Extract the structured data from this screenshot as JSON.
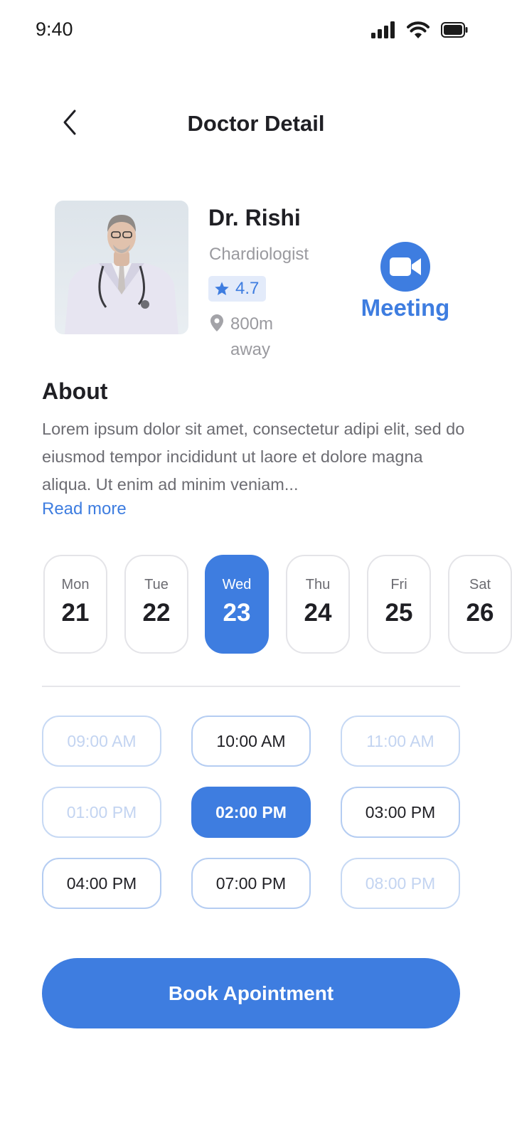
{
  "status_bar": {
    "time": "9:40"
  },
  "header": {
    "title": "Doctor Detail"
  },
  "doctor": {
    "name": "Dr. Rishi",
    "specialty": "Chardiologist",
    "rating": "4.7",
    "distance_line1": "800m",
    "distance_line2": "away",
    "meeting_label": "Meeting"
  },
  "about": {
    "title": "About",
    "text": "Lorem ipsum dolor sit amet, consectetur adipi elit, sed do eiusmod tempor incididunt ut laore et dolore magna aliqua. Ut enim ad minim veniam...",
    "read_more": "Read more"
  },
  "days": [
    {
      "name": "Mon",
      "num": "21"
    },
    {
      "name": "Tue",
      "num": "22"
    },
    {
      "name": "Wed",
      "num": "23"
    },
    {
      "name": "Thu",
      "num": "24"
    },
    {
      "name": "Fri",
      "num": "25"
    },
    {
      "name": "Sat",
      "num": "26"
    }
  ],
  "selected_day": "Wed",
  "time_slots": [
    {
      "label": "09:00 AM",
      "state": "disabled"
    },
    {
      "label": "10:00 AM",
      "state": "available"
    },
    {
      "label": "11:00 AM",
      "state": "disabled"
    },
    {
      "label": "01:00 PM",
      "state": "disabled"
    },
    {
      "label": "02:00 PM",
      "state": "selected"
    },
    {
      "label": "03:00 PM",
      "state": "available"
    },
    {
      "label": "04:00 PM",
      "state": "available"
    },
    {
      "label": "07:00 PM",
      "state": "available"
    },
    {
      "label": "08:00 PM",
      "state": "disabled"
    }
  ],
  "book_button": "Book Apointment",
  "colors": {
    "accent": "#3e7de0",
    "text_dark": "#1f1f24",
    "text_gray": "#9a9a9f",
    "rating_bg": "#e3ebfa"
  },
  "icons": [
    "signal-icon",
    "wifi-icon",
    "battery-icon",
    "back-arrow-icon",
    "star-icon",
    "location-pin-icon",
    "video-camera-icon"
  ]
}
